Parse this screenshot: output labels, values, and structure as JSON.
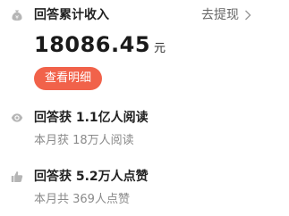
{
  "earnings": {
    "title": "回答累计收入",
    "amount": "18086.45",
    "unit": "元",
    "withdraw_label": "去提现",
    "details_button": "查看明细"
  },
  "reads": {
    "title": "回答获 1.1亿人阅读",
    "subtitle": "本月获 18万人阅读",
    "icon": "eye-icon"
  },
  "likes": {
    "title": "回答获 5.2万人点赞",
    "subtitle": "本月共 369人点赞",
    "icon": "thumbs-up-icon"
  },
  "colors": {
    "accent": "#f1624a",
    "icon_gray": "#b5b5b5",
    "muted_text": "#8a8a8a"
  }
}
